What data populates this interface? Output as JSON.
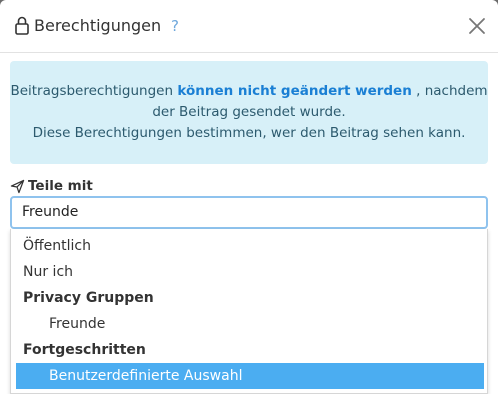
{
  "dialog": {
    "title": "Berechtigungen",
    "help": "?",
    "close_icon": "close-icon"
  },
  "info": {
    "line1_prefix": "Beitragsberechtigungen",
    "line1_strong": "können nicht geändert werden",
    "line1_suffix": ", nachdem",
    "line2": "der Beitrag gesendet wurde.",
    "line3": "Diese Berechtigungen bestimmen, wer den Beitrag sehen kann."
  },
  "share": {
    "label": "Teile mit",
    "icon": "paper-plane-icon",
    "selected_value": "Freunde"
  },
  "dropdown": {
    "options": [
      {
        "label": "Öffentlich",
        "type": "option"
      },
      {
        "label": "Nur ich",
        "type": "option"
      },
      {
        "label": "Privacy Gruppen",
        "type": "group"
      },
      {
        "label": "Freunde",
        "type": "option",
        "indent": true
      },
      {
        "label": "Fortgeschritten",
        "type": "group"
      },
      {
        "label": "Benutzerdefinierte Auswahl",
        "type": "option",
        "indent": true,
        "highlighted": true
      }
    ]
  },
  "colors": {
    "accent": "#1a7fd4",
    "info_bg": "#d7f0f8",
    "highlight": "#4badf1"
  }
}
